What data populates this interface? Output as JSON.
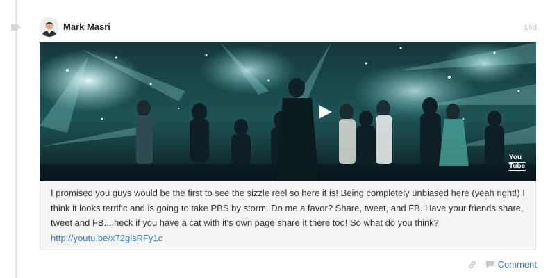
{
  "post": {
    "author_name": "Mark Masri",
    "timestamp": "18d",
    "video": {
      "play_icon": "play-icon",
      "provider_icon": "youtube-icon",
      "provider_you": "You",
      "provider_tube": "Tube"
    },
    "text": "I promised you guys would be the first to see the sizzle reel so here it is! Being completely unbiased here (yeah right!) I think it looks terrific and is going to take PBS by storm. Do me a favor? Share, tweet, and FB. Have your friends share, tweet and FB....heck if you have a cat with it's own page share it there too! So what do you think?",
    "link": "http://youtu.be/x72glsRFy1c"
  },
  "actions": {
    "link_icon": "link-icon",
    "comment_icon": "comment-icon",
    "comment_label": "Comment"
  },
  "colors": {
    "link": "#3a7ebf",
    "timeline": "#e6e6e6",
    "body_bg": "#f5f5f5"
  }
}
